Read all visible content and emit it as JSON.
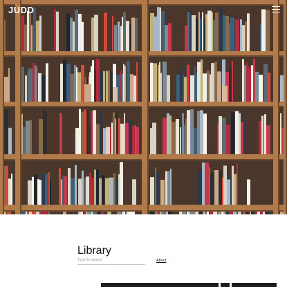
{
  "header": {
    "brand": "JUDD",
    "menu_icon": "hamburger-menu-icon"
  },
  "page": {
    "title": "Library"
  },
  "search": {
    "placeholder": "Type to search",
    "value": ""
  },
  "nav": {
    "about_label": "About"
  },
  "colors": {
    "shelf_wood": "#b07a4a",
    "shelf_dark": "#6e4a2c",
    "back_wall": "#4a362a",
    "accent_red": "#c8374a"
  },
  "hero_image": {
    "subject": "bookshelves-photo"
  }
}
